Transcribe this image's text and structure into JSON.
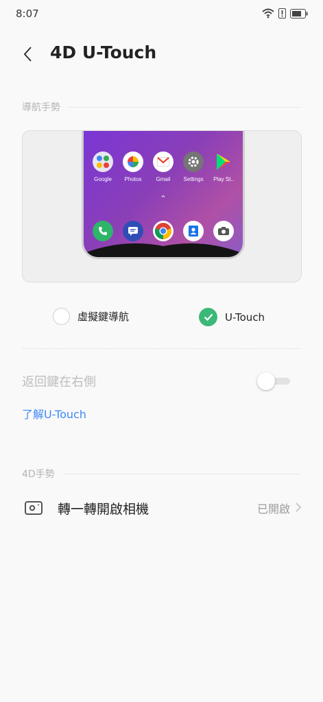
{
  "status_bar": {
    "time": "8:07",
    "icons": [
      "wifi-icon",
      "alert-icon",
      "battery-icon"
    ]
  },
  "header": {
    "title": "4D U-Touch",
    "back_icon": "back-arrow-icon"
  },
  "sections": {
    "nav_gesture": "導航手勢",
    "gesture_4d": "4D手勢"
  },
  "preview": {
    "apps_row1": [
      {
        "label": "Google",
        "icon": "google-folder-icon",
        "color": "#e8e8f0"
      },
      {
        "label": "Photos",
        "icon": "photos-icon",
        "color": "#ffffff"
      },
      {
        "label": "Gmail",
        "icon": "gmail-icon",
        "color": "#ffffff"
      },
      {
        "label": "Settings",
        "icon": "settings-icon",
        "color": "#757575"
      },
      {
        "label": "Play St..",
        "icon": "play-store-icon",
        "color": "transparent"
      }
    ],
    "apps_dock": [
      {
        "icon": "phone-icon",
        "color": "#2fb569"
      },
      {
        "icon": "messages-icon",
        "color": "#2f4db5"
      },
      {
        "icon": "chrome-icon",
        "color": "#ffffff"
      },
      {
        "icon": "contacts-icon",
        "color": "#ffffff"
      },
      {
        "icon": "camera-icon",
        "color": "#ffffff"
      }
    ]
  },
  "nav_options": {
    "virtual_keys": "虛擬鍵導航",
    "u_touch": "U-Touch",
    "selected": "U-Touch"
  },
  "back_key_right": {
    "label": "返回鍵在右側",
    "enabled": false
  },
  "learn_link": "了解U-Touch",
  "camera_gesture": {
    "label": "轉一轉開啟相機",
    "value": "已開啟"
  },
  "colors": {
    "accent": "#3cb878",
    "link": "#3d8af7"
  }
}
